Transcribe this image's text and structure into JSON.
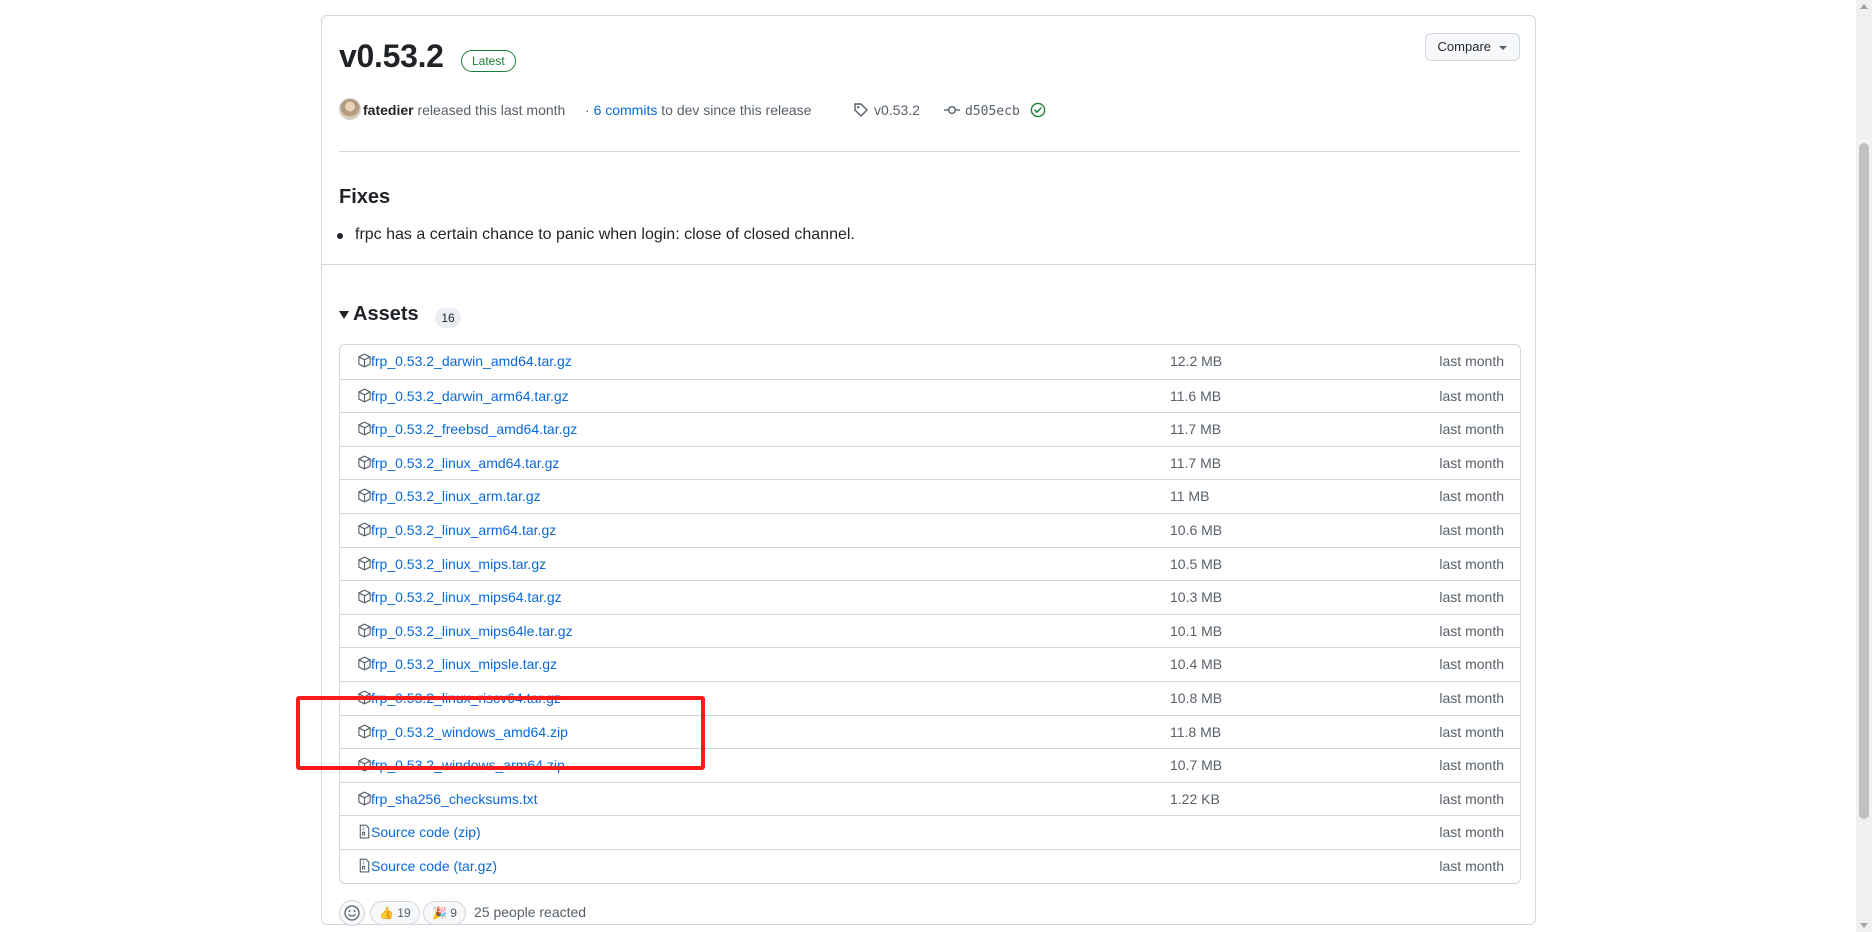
{
  "release": {
    "title": "v0.53.2",
    "latest_label": "Latest",
    "compare_label": "Compare",
    "author": "fatedier",
    "released_text": "released this last month",
    "commits_dot": "·",
    "commits_link": "6 commits",
    "commits_suffix": "to dev since this release",
    "tag": "v0.53.2",
    "commit_sha": "d505ecb"
  },
  "notes": {
    "heading": "Fixes",
    "items": [
      "frpc has a certain chance to panic when login: close of closed channel."
    ]
  },
  "assets": {
    "heading": "Assets",
    "count": "16",
    "rows": [
      {
        "name": "frp_0.53.2_darwin_amd64.tar.gz",
        "size": "12.2 MB",
        "date": "last month"
      },
      {
        "name": "frp_0.53.2_darwin_arm64.tar.gz",
        "size": "11.6 MB",
        "date": "last month"
      },
      {
        "name": "frp_0.53.2_freebsd_amd64.tar.gz",
        "size": "11.7 MB",
        "date": "last month"
      },
      {
        "name": "frp_0.53.2_linux_amd64.tar.gz",
        "size": "11.7 MB",
        "date": "last month"
      },
      {
        "name": "frp_0.53.2_linux_arm.tar.gz",
        "size": "11 MB",
        "date": "last month"
      },
      {
        "name": "frp_0.53.2_linux_arm64.tar.gz",
        "size": "10.6 MB",
        "date": "last month"
      },
      {
        "name": "frp_0.53.2_linux_mips.tar.gz",
        "size": "10.5 MB",
        "date": "last month"
      },
      {
        "name": "frp_0.53.2_linux_mips64.tar.gz",
        "size": "10.3 MB",
        "date": "last month"
      },
      {
        "name": "frp_0.53.2_linux_mips64le.tar.gz",
        "size": "10.1 MB",
        "date": "last month"
      },
      {
        "name": "frp_0.53.2_linux_mipsle.tar.gz",
        "size": "10.4 MB",
        "date": "last month"
      },
      {
        "name": "frp_0.53.2_linux_riscv64.tar.gz",
        "size": "10.8 MB",
        "date": "last month"
      },
      {
        "name": "frp_0.53.2_windows_amd64.zip",
        "size": "11.8 MB",
        "date": "last month"
      },
      {
        "name": "frp_0.53.2_windows_arm64.zip",
        "size": "10.7 MB",
        "date": "last month"
      },
      {
        "name": "frp_sha256_checksums.txt",
        "size": "1.22 KB",
        "date": "last month"
      },
      {
        "name": "Source code",
        "sub": "(zip)",
        "size": "",
        "date": "last month",
        "icon": "file-zip-icon"
      },
      {
        "name": "Source code",
        "sub": "(tar.gz)",
        "size": "",
        "date": "last month",
        "icon": "file-zip-icon"
      }
    ]
  },
  "reactions": {
    "thumbs_count": "19",
    "hooray_count": "9",
    "summary": "25 people reacted",
    "thumbs_emoji": "👍",
    "hooray_emoji": "🎉"
  },
  "colors": {
    "link": "#0969da",
    "latest_badge": "#1a7f37",
    "highlight_box": "#ff1a1a"
  }
}
